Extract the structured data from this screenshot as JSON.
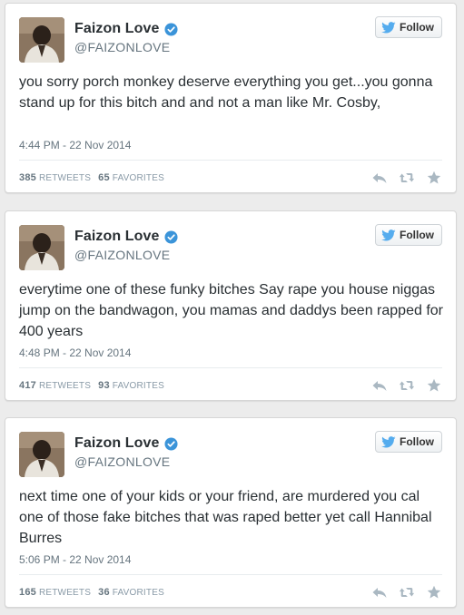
{
  "colors": {
    "verified": "#3b94d9",
    "twitter_blue": "#55acee",
    "text": "#292f33",
    "muted": "#66757f",
    "action_icon": "#aab8c2"
  },
  "tweets": [
    {
      "display_name": "Faizon Love",
      "handle": "@FAIZONLOVE",
      "follow_label": "Follow",
      "text": "you sorry porch monkey deserve everything you get...you gonna stand up for this bitch and and not a man like Mr. Cosby,",
      "timestamp": "4:44 PM - 22 Nov 2014",
      "retweets": "385",
      "retweets_label": "RETWEETS",
      "favorites": "65",
      "favorites_label": "FAVORITES",
      "icons": [
        "verified-badge-icon",
        "twitter-bird-icon",
        "reply-icon",
        "retweet-icon",
        "favorite-star-icon"
      ]
    },
    {
      "display_name": "Faizon Love",
      "handle": "@FAIZONLOVE",
      "follow_label": "Follow",
      "text": "everytime one of these funky bitches  Say rape you house niggas  jump on the bandwagon, you mamas and daddys been rapped for 400 years",
      "timestamp": "4:48 PM - 22 Nov 2014",
      "retweets": "417",
      "retweets_label": "RETWEETS",
      "favorites": "93",
      "favorites_label": "FAVORITES",
      "icons": [
        "verified-badge-icon",
        "twitter-bird-icon",
        "reply-icon",
        "retweet-icon",
        "favorite-star-icon"
      ]
    },
    {
      "display_name": "Faizon Love",
      "handle": "@FAIZONLOVE",
      "follow_label": "Follow",
      "text": "next time one of your kids or your friend, are murdered you cal one of those fake bitches that was raped better yet call Hannibal Burres",
      "timestamp": "5:06 PM - 22 Nov 2014",
      "retweets": "165",
      "retweets_label": "RETWEETS",
      "favorites": "36",
      "favorites_label": "FAVORITES",
      "icons": [
        "verified-badge-icon",
        "twitter-bird-icon",
        "reply-icon",
        "retweet-icon",
        "favorite-star-icon"
      ]
    }
  ]
}
